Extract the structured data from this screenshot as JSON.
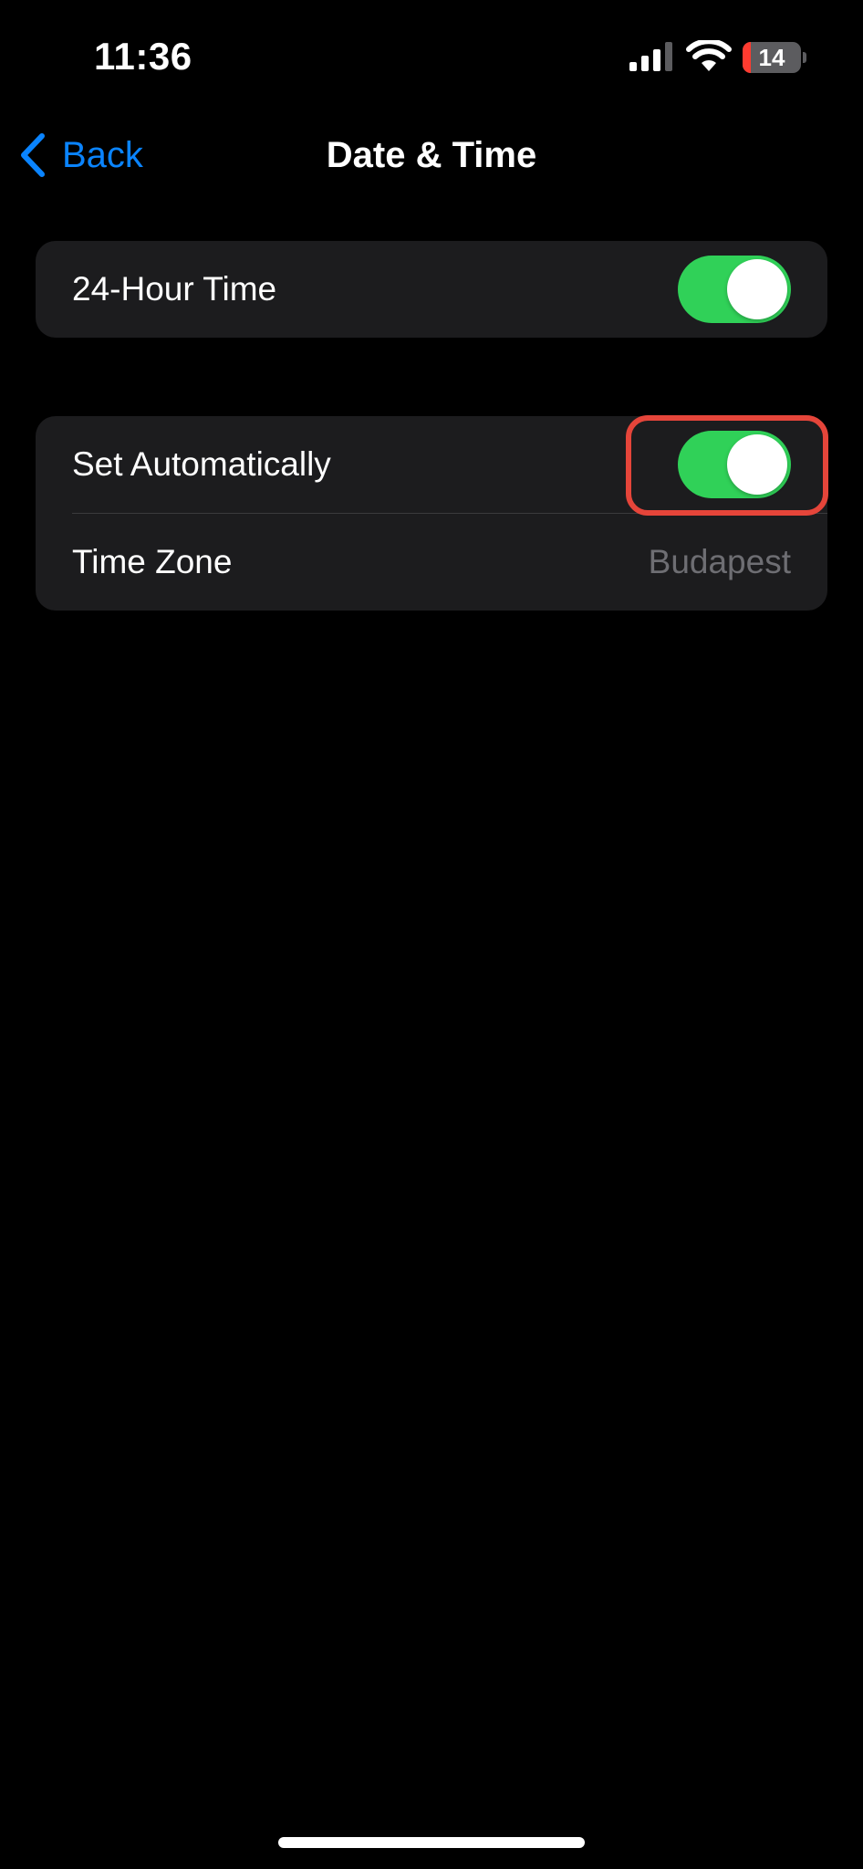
{
  "status_bar": {
    "time": "11:36",
    "battery_level": "14",
    "battery_percent": 14,
    "battery_color": "#ff3b30",
    "icons": [
      "cellular-signal-icon",
      "wifi-icon",
      "battery-icon"
    ]
  },
  "nav": {
    "back_label": "Back",
    "back_icon": "chevron-left-icon",
    "title": "Date & Time",
    "accent_color": "#0a84ff"
  },
  "settings": {
    "hour24": {
      "label": "24-Hour Time",
      "enabled": true
    },
    "set_automatically": {
      "label": "Set Automatically",
      "enabled": true,
      "highlighted": true
    },
    "time_zone": {
      "label": "Time Zone",
      "value": "Budapest"
    }
  },
  "colors": {
    "toggle_on": "#30d158",
    "highlight": "#e5453a",
    "cell_background": "#1c1c1e"
  }
}
